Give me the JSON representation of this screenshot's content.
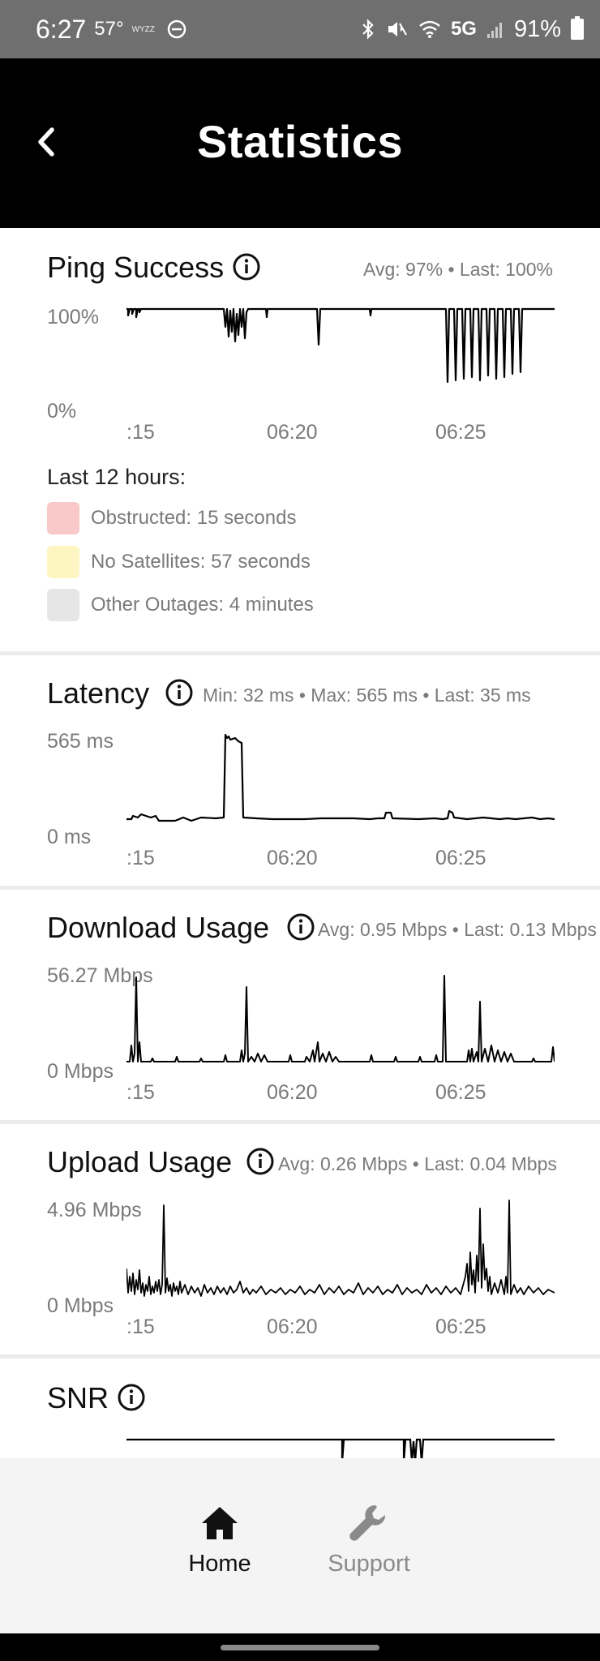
{
  "status_bar": {
    "time": "6:27",
    "temperature": "57°",
    "carrier": "WYZZ",
    "network": "5G",
    "battery": "91%"
  },
  "header": {
    "title": "Statistics"
  },
  "ping": {
    "title": "Ping Success",
    "summary": "Avg: 97% • Last: 100%",
    "y_max": "100%",
    "y_min": "0%",
    "x_ticks": [
      ":15",
      "06:20",
      "06:25"
    ],
    "legend_title": "Last 12 hours:",
    "legend": [
      {
        "label": "Obstructed: 15 seconds",
        "color": "#f9c9c9"
      },
      {
        "label": "No Satellites: 57 seconds",
        "color": "#fdf6c3"
      },
      {
        "label": "Other Outages: 4 minutes",
        "color": "#e6e6e6"
      }
    ]
  },
  "latency": {
    "title": "Latency",
    "summary": "Min: 32 ms • Max: 565 ms • Last: 35 ms",
    "y_max": "565 ms",
    "y_min": "0 ms",
    "x_ticks": [
      ":15",
      "06:20",
      "06:25"
    ]
  },
  "download": {
    "title": "Download Usage",
    "summary": "Avg: 0.95 Mbps • Last: 0.13 Mbps",
    "y_max": "56.27 Mbps",
    "y_min": "0 Mbps",
    "x_ticks": [
      ":15",
      "06:20",
      "06:25"
    ]
  },
  "upload": {
    "title": "Upload Usage",
    "summary": "Avg: 0.26 Mbps • Last: 0.04 Mbps",
    "y_max": "4.96 Mbps",
    "y_min": "0 Mbps",
    "x_ticks": [
      ":15",
      "06:20",
      "06:25"
    ]
  },
  "snr": {
    "title": "SNR"
  },
  "bottom_nav": {
    "items": [
      {
        "label": "Home",
        "icon": "home-icon",
        "active": true
      },
      {
        "label": "Support",
        "icon": "wrench-icon",
        "active": false
      }
    ]
  },
  "colors": {
    "active": "#111111",
    "inactive": "#8a8a8a",
    "line": "#000000"
  }
}
